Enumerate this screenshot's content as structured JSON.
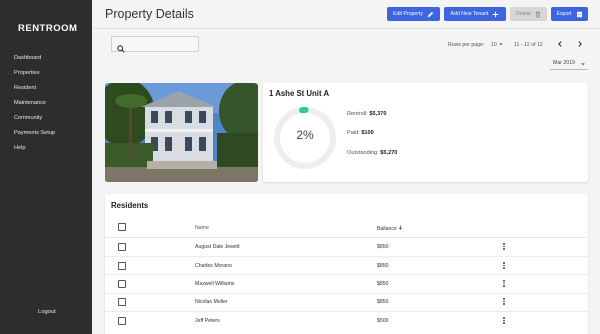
{
  "sidebar": {
    "brand": "RENTROOM",
    "items": [
      {
        "label": "Dashboard"
      },
      {
        "label": "Properties"
      },
      {
        "label": "Resident"
      },
      {
        "label": "Maintenance"
      },
      {
        "label": "Community"
      },
      {
        "label": "Payments Setup"
      },
      {
        "label": "Help"
      }
    ],
    "logout": "Logout"
  },
  "header": {
    "title": "Property Details",
    "buttons": {
      "edit_property": "Edit Property",
      "add_tenant": "Add New Tenant",
      "delete": "Delete",
      "export": "Export"
    }
  },
  "toolbar": {
    "search_placeholder": "",
    "rows_per_page_label": "Rows per page:",
    "rows_per_page_value": "10",
    "range": "11 - 12 of 12",
    "month": "Mar 2019"
  },
  "property": {
    "address": "1 Ashe St Unit A",
    "progress_percent": 2,
    "progress_label": "2%",
    "rentroll_label": "Rentroll:",
    "rentroll_value": "$5,370",
    "paid_label": "Paid:",
    "paid_value": "$100",
    "outstanding_label": "Outstanding:",
    "outstanding_value": "$5,270"
  },
  "residents": {
    "title": "Residents",
    "columns": {
      "name": "Name",
      "balance": "Ballance"
    },
    "rows": [
      {
        "name": "August Dale Jewett",
        "balance": "$850"
      },
      {
        "name": "Charles Morano",
        "balance": "$850"
      },
      {
        "name": "Maxwell Williams",
        "balance": "$850"
      },
      {
        "name": "Nicolas Muller",
        "balance": "$850"
      },
      {
        "name": "Jeff Peters",
        "balance": "$500"
      }
    ]
  },
  "colors": {
    "accent": "#3f64e0",
    "sidebar_bg": "#2d2d2d",
    "progress": "#2ecc8a",
    "track": "#eeeeee"
  }
}
